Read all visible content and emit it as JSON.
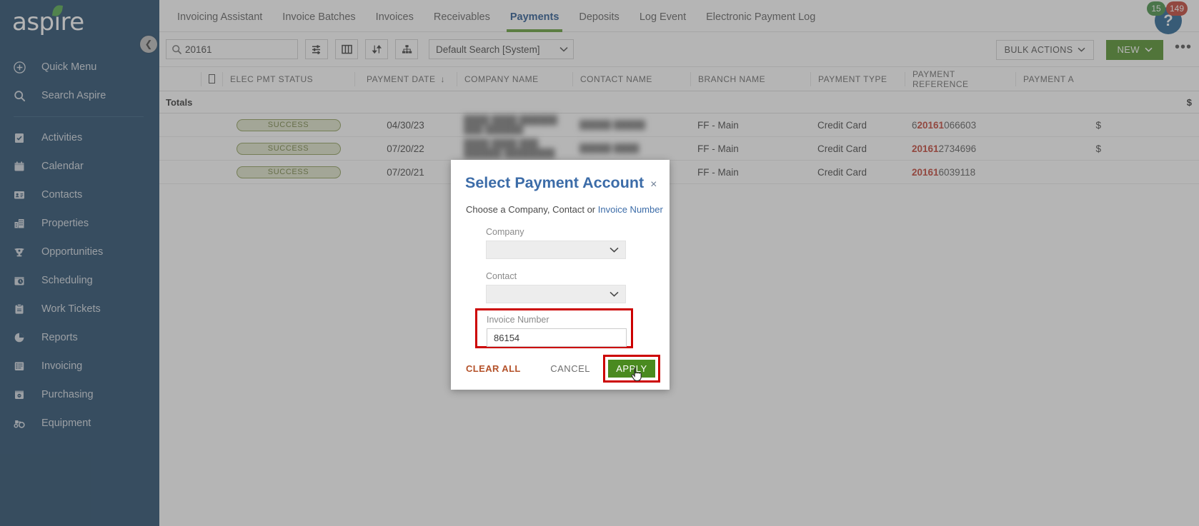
{
  "app": {
    "brand": "aspire",
    "collapse_icon": "chevron-left-icon"
  },
  "sidebar": {
    "quick": [
      {
        "label": "Quick Menu",
        "icon": "plus-circle-icon"
      },
      {
        "label": "Search Aspire",
        "icon": "search-icon"
      }
    ],
    "items": [
      {
        "label": "Activities",
        "icon": "clipboard-check-icon"
      },
      {
        "label": "Calendar",
        "icon": "calendar-icon"
      },
      {
        "label": "Contacts",
        "icon": "contact-card-icon"
      },
      {
        "label": "Properties",
        "icon": "building-icon"
      },
      {
        "label": "Opportunities",
        "icon": "trophy-icon"
      },
      {
        "label": "Scheduling",
        "icon": "schedule-clock-icon"
      },
      {
        "label": "Work Tickets",
        "icon": "clipboard-icon"
      },
      {
        "label": "Reports",
        "icon": "pie-chart-icon"
      },
      {
        "label": "Invoicing",
        "icon": "invoice-list-icon"
      },
      {
        "label": "Purchasing",
        "icon": "purchase-box-icon"
      },
      {
        "label": "Equipment",
        "icon": "tractor-icon"
      }
    ]
  },
  "topbar": {
    "tabs": [
      {
        "label": "Invoicing Assistant",
        "active": false
      },
      {
        "label": "Invoice Batches",
        "active": false
      },
      {
        "label": "Invoices",
        "active": false
      },
      {
        "label": "Receivables",
        "active": false
      },
      {
        "label": "Payments",
        "active": true
      },
      {
        "label": "Deposits",
        "active": false
      },
      {
        "label": "Log Event",
        "active": false
      },
      {
        "label": "Electronic Payment Log",
        "active": false
      }
    ],
    "help": {
      "icon": "help-question-icon",
      "glyph": "?",
      "badge_green": "15",
      "badge_red": "149",
      "green_color": "#3d8b3d",
      "red_color": "#c0392b"
    }
  },
  "toolbar": {
    "search_value": "20161",
    "search_placeholder": "Search",
    "search_icon": "search-icon",
    "buttons": [
      {
        "name": "filter-settings-button",
        "icon": "sliders-icon"
      },
      {
        "name": "columns-button",
        "icon": "columns-icon"
      },
      {
        "name": "sort-button",
        "icon": "sort-arrows-icon"
      },
      {
        "name": "group-button",
        "icon": "hierarchy-icon"
      }
    ],
    "saved_search": "Default Search [System]",
    "bulk_actions_label": "BULK ACTIONS",
    "new_label": "NEW",
    "more_label": "•••"
  },
  "table": {
    "columns": [
      "ELEC PMT STATUS",
      "PAYMENT DATE",
      "COMPANY NAME",
      "CONTACT NAME",
      "BRANCH NAME",
      "PAYMENT TYPE",
      "PAYMENT REFERENCE",
      "PAYMENT A"
    ],
    "sort_column": "PAYMENT DATE",
    "sort_arrow": "↓",
    "totals_label": "Totals",
    "totals_amount": "$",
    "rows": [
      {
        "status": "SUCCESS",
        "date": "04/30/23",
        "company": "████ ████ ██████ ███ ██████",
        "contact": "█████ █████",
        "branch": "FF - Main",
        "type": "Credit Card",
        "ref_pre": "6",
        "ref_match": "20161",
        "ref_post": "066603",
        "amount": "$"
      },
      {
        "status": "SUCCESS",
        "date": "07/20/22",
        "company": "████ ████ ███ ██████ ████████",
        "contact": "█████ ████",
        "branch": "FF - Main",
        "type": "Credit Card",
        "ref_pre": "",
        "ref_match": "20161",
        "ref_post": "2734696",
        "amount": "$"
      },
      {
        "status": "SUCCESS",
        "date": "07/20/21",
        "company": "",
        "contact": "",
        "branch": "FF - Main",
        "type": "Credit Card",
        "ref_pre": "",
        "ref_match": "20161",
        "ref_post": "6039118",
        "amount": ""
      }
    ]
  },
  "modal": {
    "title": "Select Payment Account",
    "close_label": "×",
    "subtitle_plain": "Choose a Company, Contact or ",
    "subtitle_link": "Invoice Number",
    "company_label": "Company",
    "company_value": "",
    "contact_label": "Contact",
    "contact_value": "",
    "invoice_label": "Invoice Number",
    "invoice_value": "86154",
    "clear_all_label": "CLEAR ALL",
    "cancel_label": "CANCEL",
    "apply_label": "APPLY",
    "highlight_color": "#cc0000",
    "apply_color": "#4a8a20",
    "title_color": "#3c6ca8"
  }
}
